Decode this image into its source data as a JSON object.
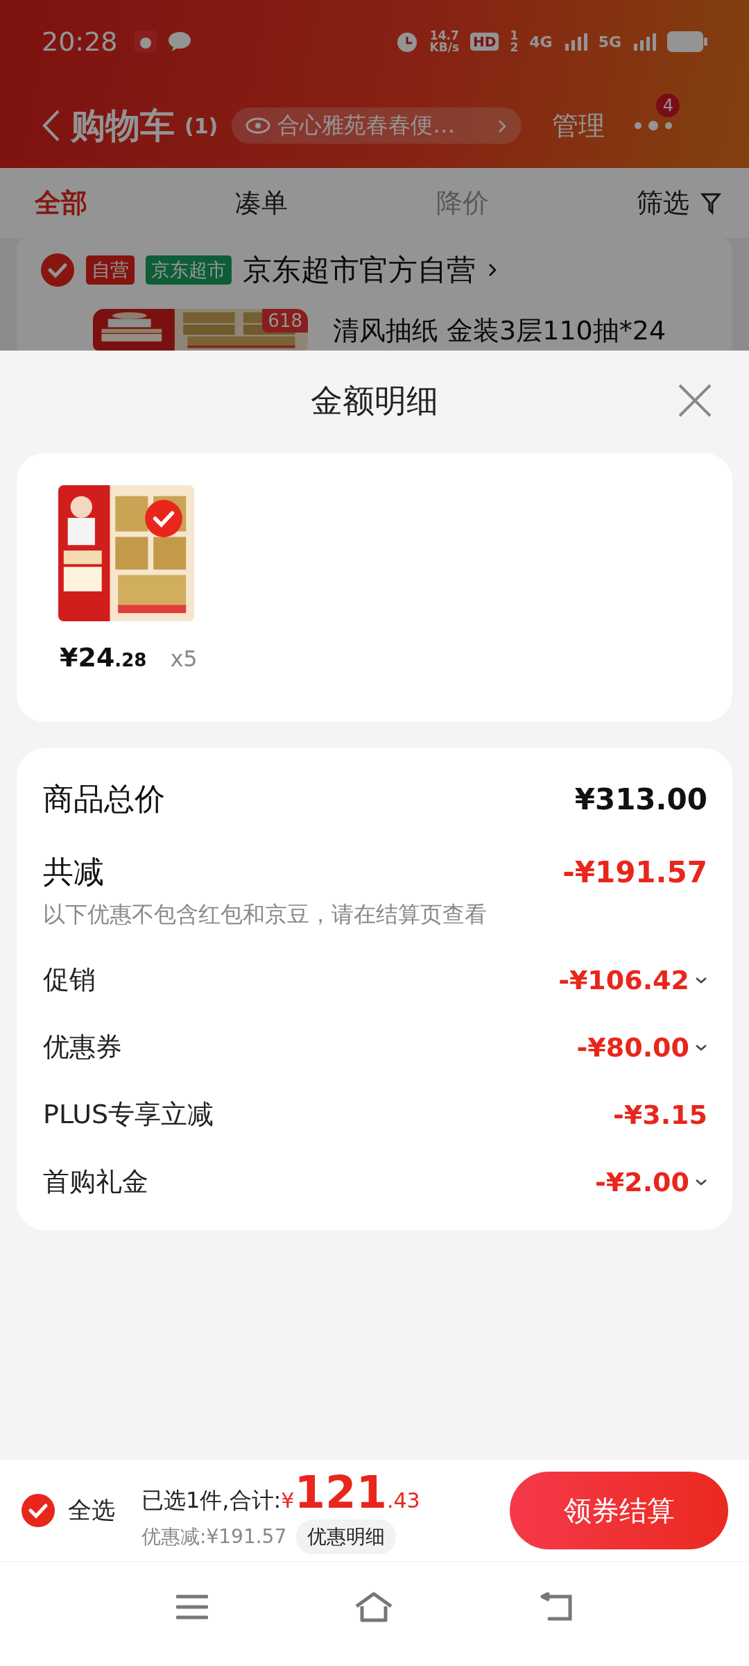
{
  "status_bar": {
    "time": "20:28",
    "speed": "14.7",
    "speed_unit": "KB/s",
    "hd": "HD",
    "sim_1": "1",
    "sim_2": "2",
    "network_1": "4G",
    "network_2": "5G"
  },
  "header": {
    "title": "购物车",
    "count": "(1)",
    "recent_view": "合心雅苑春春便…",
    "manage": "管理",
    "badge": "4"
  },
  "tabs": [
    {
      "label": "全部",
      "selected": true,
      "disabled": false,
      "kind": "text"
    },
    {
      "label": "凑单",
      "selected": false,
      "disabled": false,
      "kind": "text"
    },
    {
      "label": "降价",
      "selected": false,
      "disabled": true,
      "kind": "text"
    },
    {
      "label": "筛选",
      "selected": false,
      "disabled": false,
      "kind": "filter"
    }
  ],
  "store": {
    "checked": true,
    "tags": [
      {
        "label": "自营",
        "kind": "self"
      },
      {
        "label": "京东超市",
        "kind": "supermarket"
      }
    ],
    "name": "京东超市官方自营"
  },
  "cart_item": {
    "badge": "618",
    "title": "清风抽纸 金装3层110抽*24"
  },
  "sheet": {
    "title": "金额明细",
    "products": [
      {
        "selected": true,
        "price": "¥24",
        "price_decimal": ".28",
        "quantity": "x5"
      }
    ],
    "total": {
      "label": "商品总价",
      "amount": "¥313.00"
    },
    "discount": {
      "label": "共减",
      "amount": "-¥191.57",
      "note": "以下优惠不包含红包和京豆，请在结算页查看"
    },
    "details": [
      {
        "label": "促销",
        "amount": "-¥106.42",
        "expandable": true
      },
      {
        "label": "优惠券",
        "amount": "-¥80.00",
        "expandable": true
      },
      {
        "label": "PLUS专享立减",
        "amount": "-¥3.15",
        "expandable": false
      },
      {
        "label": "首购礼金",
        "amount": "-¥2.00",
        "expandable": true
      }
    ]
  },
  "footer": {
    "select_all": {
      "label": "全选",
      "checked": true
    },
    "summary": "已选1件,合计:",
    "currency": "¥",
    "total": "121",
    "total_decimal": ".43",
    "saved": "优惠减:¥191.57",
    "detail_button": "优惠明细",
    "checkout": "领券结算"
  }
}
